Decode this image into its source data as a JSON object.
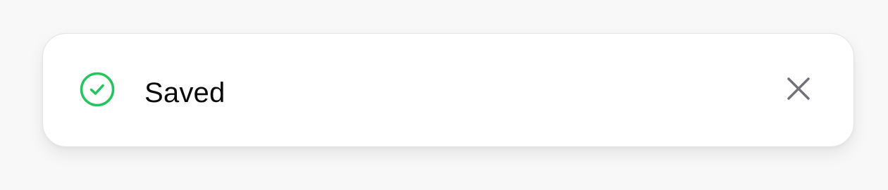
{
  "toast": {
    "message": "Saved",
    "status_icon": "check-circle-icon",
    "close_icon": "close-icon",
    "success_color": "#22c55e",
    "close_color": "#71717a",
    "text_color": "#0a0a0a"
  }
}
